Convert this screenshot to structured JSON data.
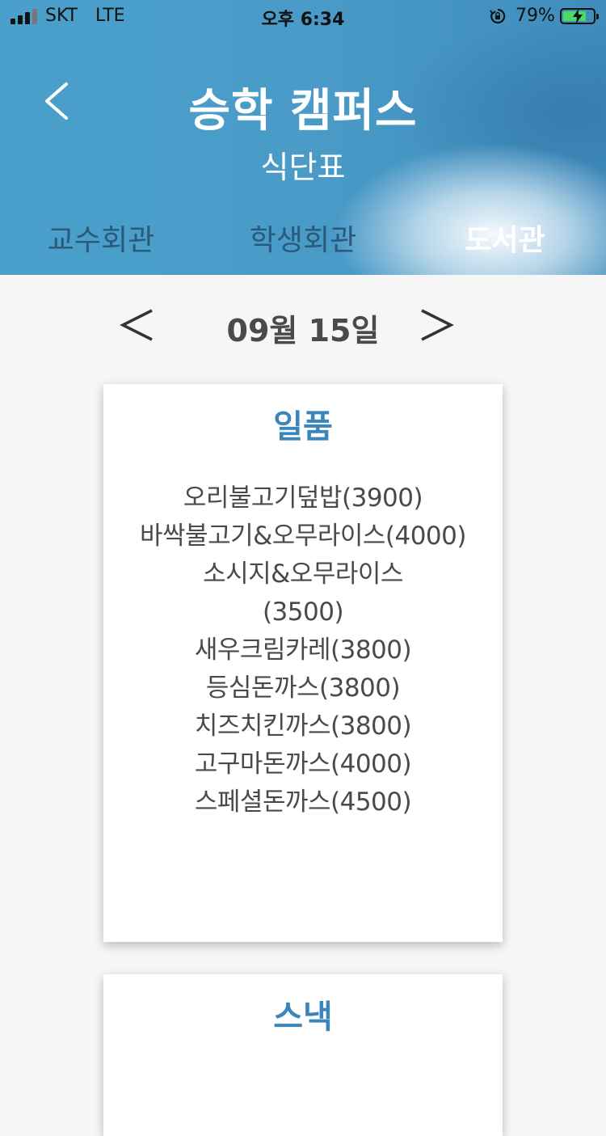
{
  "status_bar": {
    "carrier": "SKT",
    "network": "LTE",
    "time": "오후 6:34",
    "battery_percent": "79%",
    "battery_level": 0.79,
    "icons": [
      "signal-icon",
      "orientation-lock-icon",
      "battery-charging-icon"
    ]
  },
  "header": {
    "title": "승학 캠퍼스",
    "subtitle": "식단표",
    "back_icon": "chevron-left-icon"
  },
  "tabs": [
    {
      "label": "교수회관",
      "active": false
    },
    {
      "label": "학생회관",
      "active": false
    },
    {
      "label": "도서관",
      "active": true
    }
  ],
  "date_nav": {
    "date": "09월 15일",
    "prev_icon": "chevron-left-icon",
    "next_icon": "chevron-right-icon"
  },
  "cards": [
    {
      "title": "일품",
      "items": [
        "오리불고기덮밥(3900)",
        "바싹불고기&오무라이스(4000)",
        "소시지&오무라이스 (3500)",
        "새우크림카레(3800)",
        "등심돈까스(3800)",
        "치즈치킨까스(3800)",
        "고구마돈까스(4000)",
        "스페셜돈까스(4500)"
      ]
    },
    {
      "title": "스낵",
      "items": []
    }
  ],
  "colors": {
    "header_blue": "#4a9bc8",
    "card_title": "#3a86ba",
    "text_gray": "#4a4a4a",
    "page_bg": "#f7f6f7"
  }
}
